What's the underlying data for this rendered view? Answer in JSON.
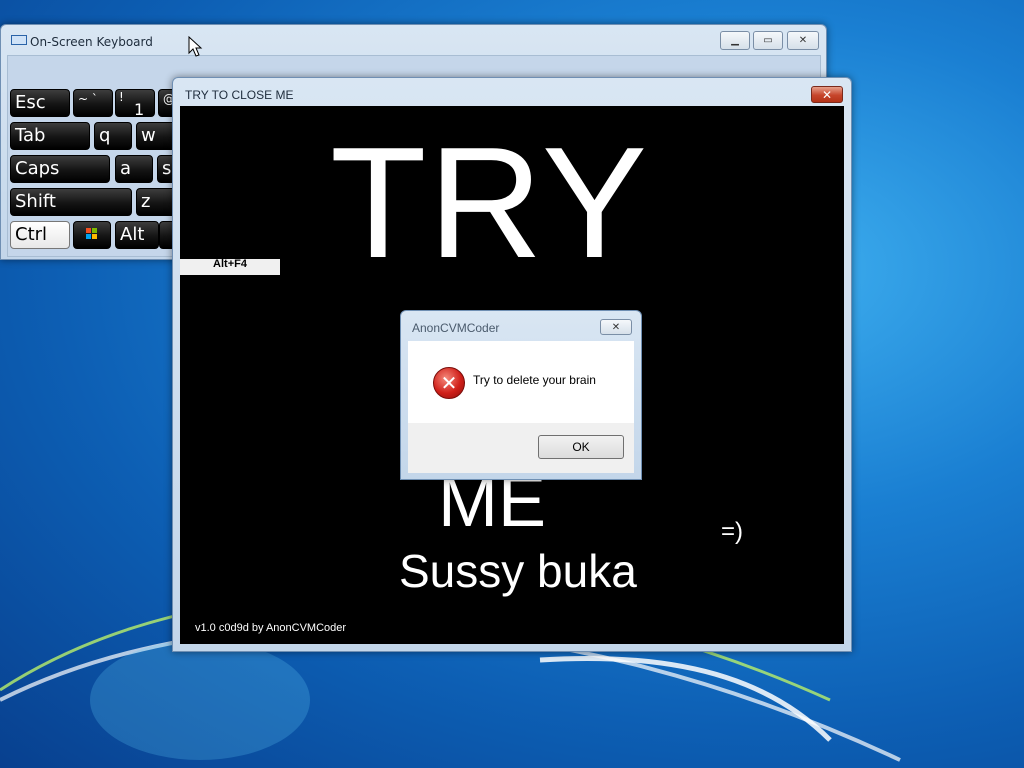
{
  "osk": {
    "title": "On-Screen Keyboard",
    "keys": {
      "esc": "Esc",
      "tilde": "~ `",
      "one_top": "!",
      "one": "1",
      "at": "@",
      "tab": "Tab",
      "q": "q",
      "w": "w",
      "caps": "Caps",
      "a": "a",
      "s": "s",
      "shift": "Shift",
      "z": "z",
      "ctrl": "Ctrl",
      "alt": "Alt"
    }
  },
  "prank": {
    "title": "TRY TO CLOSE ME",
    "altf4": "Alt+F4",
    "big_try": "TRY",
    "big_me": "ME",
    "sussy": "Sussy buka",
    "smile": "=)",
    "version": "v1.0 c0d9d by AnonCVMCoder"
  },
  "dialog": {
    "title": "AnonCVMCoder",
    "message": "Try to delete your brain",
    "ok_label": "OK"
  }
}
